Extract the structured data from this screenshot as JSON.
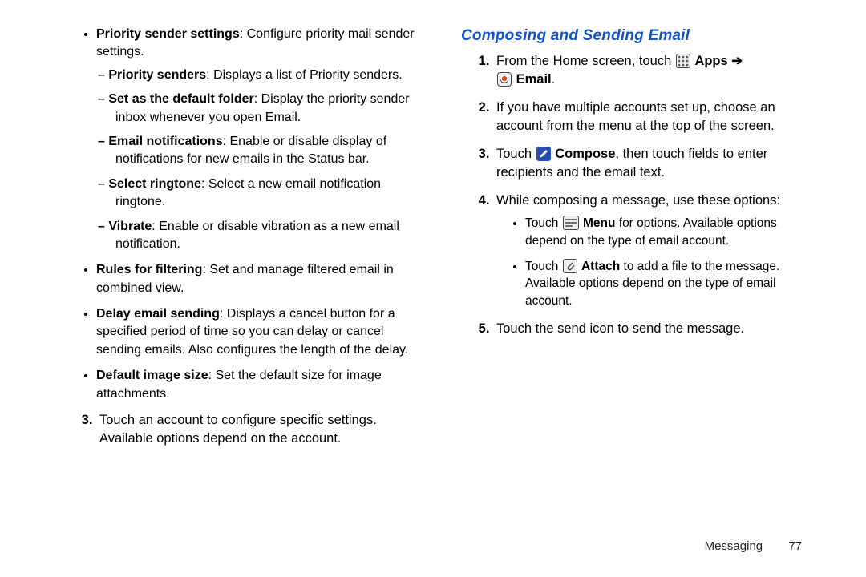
{
  "leftCol": {
    "bullets": {
      "prioritySenderSettings_lead": "Priority sender settings",
      "prioritySenderSettings_rest": ": Configure priority mail sender settings.",
      "dashes": {
        "prioritySenders_lead": "Priority senders",
        "prioritySenders_rest": ": Displays a list of Priority senders.",
        "defaultFolder_lead": "Set as the default folder",
        "defaultFolder_rest": ": Display the priority sender inbox whenever you open Email.",
        "emailNotif_lead": "Email notifications",
        "emailNotif_rest": ": Enable or disable display of notifications for new emails in the Status bar.",
        "ringtone_lead": "Select ringtone",
        "ringtone_rest": ": Select a new email notification ringtone.",
        "vibrate_lead": "Vibrate",
        "vibrate_rest": ": Enable or disable vibration as a new email notification."
      },
      "rules_lead": "Rules for filtering",
      "rules_rest": ": Set and manage filtered email in combined view.",
      "delay_lead": "Delay email sending",
      "delay_rest": ": Displays a cancel button for a specified period of time so you can delay or cancel sending emails. Also configures the length of the delay.",
      "imgsize_lead": "Default image size",
      "imgsize_rest": ": Set the default size for image attachments."
    },
    "step3_a": "Touch an account to configure specific settings. ",
    "step3_b": "Available options depend on the account."
  },
  "rightCol": {
    "heading": "Composing and Sending Email",
    "step1_pre": "From the Home screen, touch ",
    "step1_apps": "Apps",
    "step1_arrow": " ➔ ",
    "step1_email": "Email",
    "step1_post": ".",
    "step2": "If you have multiple accounts set up, choose an account from the menu at the top of the screen.",
    "step3_pre": "Touch ",
    "step3_compose": "Compose",
    "step3_post": ", then touch fields to enter recipients and the email text.",
    "step4": "While composing a message, use these options:",
    "step4_sub": {
      "menu_pre": "Touch ",
      "menu_bold": "Menu",
      "menu_post": " for options. Available options depend on the type of email account.",
      "attach_pre": "Touch ",
      "attach_bold": "Attach",
      "attach_post": " to add a file to the message. Available options depend on the type of email account."
    },
    "step5": "Touch the send icon to send the message."
  },
  "footer": {
    "section": "Messaging",
    "page": "77"
  }
}
